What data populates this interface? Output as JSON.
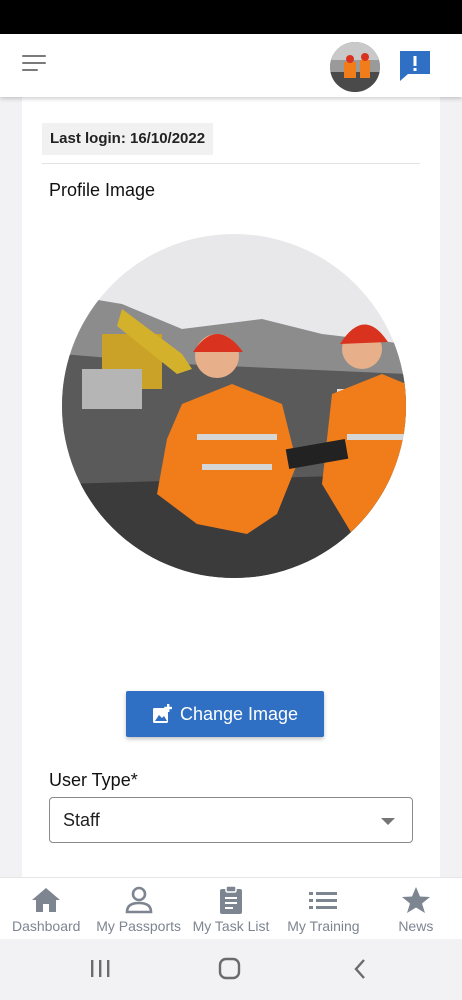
{
  "colors": {
    "accent": "#2f6fc4",
    "nav_icon": "#7d8591",
    "header_background": "#ffffff"
  },
  "header": {
    "menu_icon": "menu-icon",
    "alert_icon": "alert-icon"
  },
  "profile": {
    "last_login": "Last login: 16/10/2022",
    "section_title": "Profile Image",
    "change_image_label": "Change Image",
    "change_image_icon": "add-photo-icon"
  },
  "form": {
    "user_type_label": "User Type*",
    "user_type_value": "Staff"
  },
  "bottom_nav": {
    "items": [
      {
        "label": "Dashboard",
        "icon": "home-icon"
      },
      {
        "label": "My Passports",
        "icon": "person-icon"
      },
      {
        "label": "My Task List",
        "icon": "clipboard-icon"
      },
      {
        "label": "My Training",
        "icon": "list-icon"
      },
      {
        "label": "News",
        "icon": "star-icon"
      }
    ]
  },
  "system_nav": {
    "recent_icon": "recent-apps-icon",
    "home_icon": "home-button-icon",
    "back_icon": "back-icon"
  }
}
